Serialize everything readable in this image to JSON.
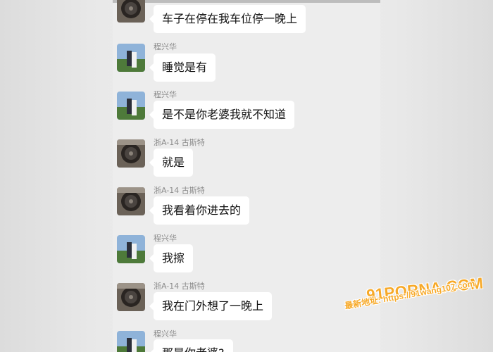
{
  "chat": {
    "messages": [
      {
        "sender": "",
        "avatar": "car-wheel",
        "text": "车子在停在我车位停一晚上"
      },
      {
        "sender": "程兴华",
        "avatar": "couple-photo",
        "text": "睡觉是有"
      },
      {
        "sender": "程兴华",
        "avatar": "couple-photo",
        "text": "是不是你老婆我就不知道"
      },
      {
        "sender": "浙A-14 古斯特",
        "avatar": "car-wheel",
        "text": "就是"
      },
      {
        "sender": "浙A-14 古斯特",
        "avatar": "car-wheel",
        "text": "我看着你进去的"
      },
      {
        "sender": "程兴华",
        "avatar": "couple-photo",
        "text": "我擦"
      },
      {
        "sender": "浙A-14 古斯特",
        "avatar": "car-wheel",
        "text": "我在门外想了一晚上"
      },
      {
        "sender": "程兴华",
        "avatar": "couple-photo",
        "text": "那是你老婆?"
      }
    ]
  },
  "watermark": {
    "logo": "91PORNA.COM",
    "url": "最新地址: https://91wang107.com"
  },
  "colors": {
    "background": "#ededed",
    "bubble": "#ffffff",
    "watermark": "#f7a928"
  }
}
